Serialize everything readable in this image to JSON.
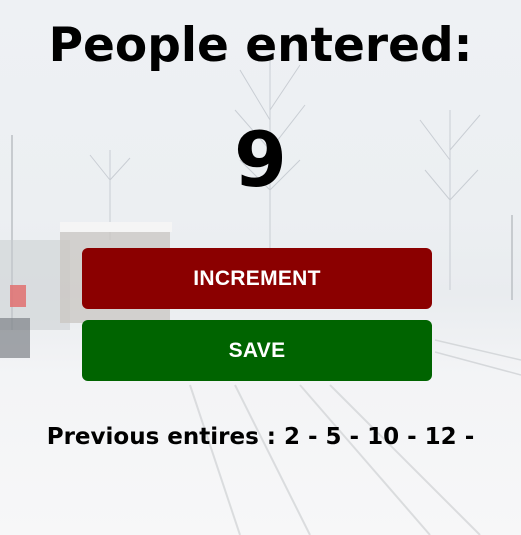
{
  "title": "People entered:",
  "count": "9",
  "buttons": {
    "increment_label": "INCREMENT",
    "save_label": "SAVE"
  },
  "previous": {
    "label": "Previous entires : ",
    "entries_text": "2 - 5 - 10 - 12 -",
    "entries": [
      2,
      5,
      10,
      12
    ]
  },
  "colors": {
    "increment_button": "#8b0000",
    "save_button": "#006400",
    "text": "#000000"
  }
}
